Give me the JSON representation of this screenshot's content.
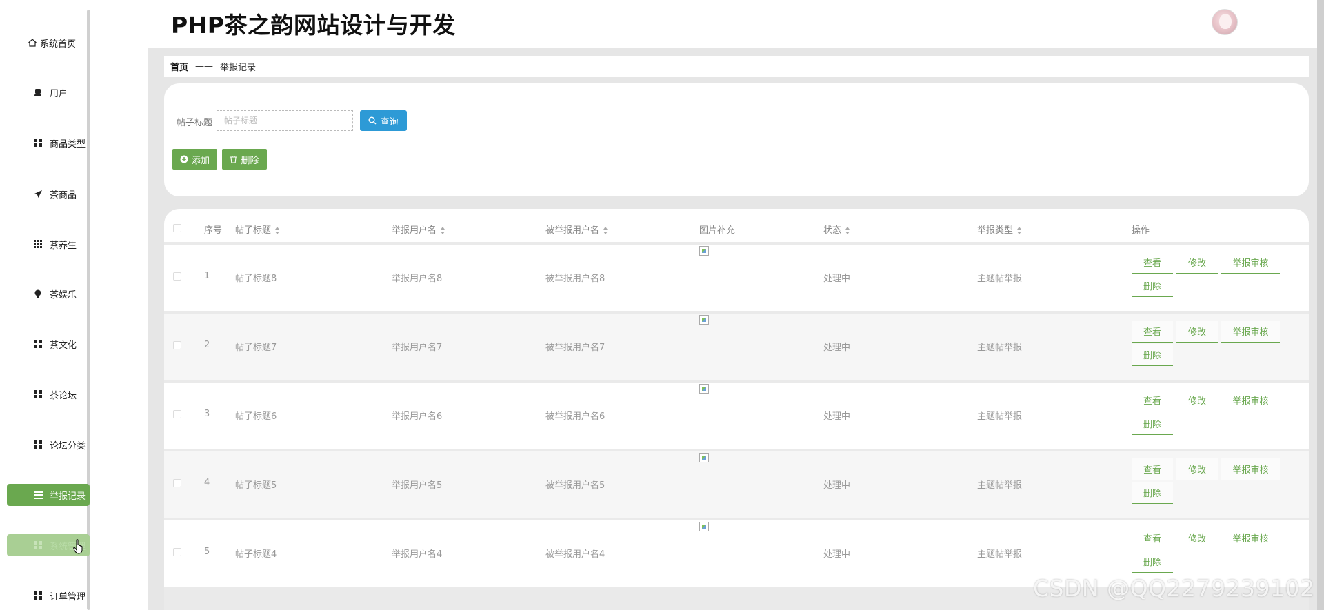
{
  "header": {
    "title": "PHP茶之韵网站设计与开发"
  },
  "sidebar": {
    "items": [
      {
        "label": "系统首页",
        "icon": "home-icon"
      },
      {
        "label": "用户",
        "icon": "user-icon"
      },
      {
        "label": "商品类型",
        "icon": "grid-icon"
      },
      {
        "label": "茶商品",
        "icon": "send-icon"
      },
      {
        "label": "茶养生",
        "icon": "grid9-icon"
      },
      {
        "label": "茶娱乐",
        "icon": "bulb-icon"
      },
      {
        "label": "茶文化",
        "icon": "grid-icon"
      },
      {
        "label": "茶论坛",
        "icon": "grid-icon"
      },
      {
        "label": "论坛分类",
        "icon": "grid-icon"
      },
      {
        "label": "举报记录",
        "icon": "menu-icon",
        "active": true
      },
      {
        "label": "系统管理",
        "icon": "grid-icon",
        "hover": true
      },
      {
        "label": "订单管理",
        "icon": "grid-icon"
      }
    ]
  },
  "breadcrumb": {
    "home": "首页",
    "separator": "——",
    "current": "举报记录"
  },
  "search": {
    "label": "帖子标题",
    "placeholder": "帖子标题",
    "value": "",
    "button": "查询"
  },
  "actions": {
    "add": "添加",
    "delete": "删除"
  },
  "table": {
    "columns": [
      "序号",
      "帖子标题",
      "举报用户名",
      "被举报用户名",
      "图片补充",
      "状态",
      "举报类型",
      "操作"
    ],
    "rows": [
      {
        "index": "1",
        "title": "帖子标题8",
        "reporter": "举报用户名8",
        "reported": "被举报用户名8",
        "status": "处理中",
        "type": "主题帖举报"
      },
      {
        "index": "2",
        "title": "帖子标题7",
        "reporter": "举报用户名7",
        "reported": "被举报用户名7",
        "status": "处理中",
        "type": "主题帖举报"
      },
      {
        "index": "3",
        "title": "帖子标题6",
        "reporter": "举报用户名6",
        "reported": "被举报用户名6",
        "status": "处理中",
        "type": "主题帖举报"
      },
      {
        "index": "4",
        "title": "帖子标题5",
        "reporter": "举报用户名5",
        "reported": "被举报用户名5",
        "status": "处理中",
        "type": "主题帖举报"
      },
      {
        "index": "5",
        "title": "帖子标题4",
        "reporter": "举报用户名4",
        "reported": "被举报用户名4",
        "status": "处理中",
        "type": "主题帖举报"
      }
    ],
    "row_actions": {
      "view": "查看",
      "edit": "修改",
      "review": "举报审核",
      "delete": "删除"
    }
  },
  "watermark": "CSDN @QQ2279239102",
  "colors": {
    "accent": "#6aa84f",
    "search_button": "#2d9ad6",
    "hover_item": "#a9cf94"
  }
}
